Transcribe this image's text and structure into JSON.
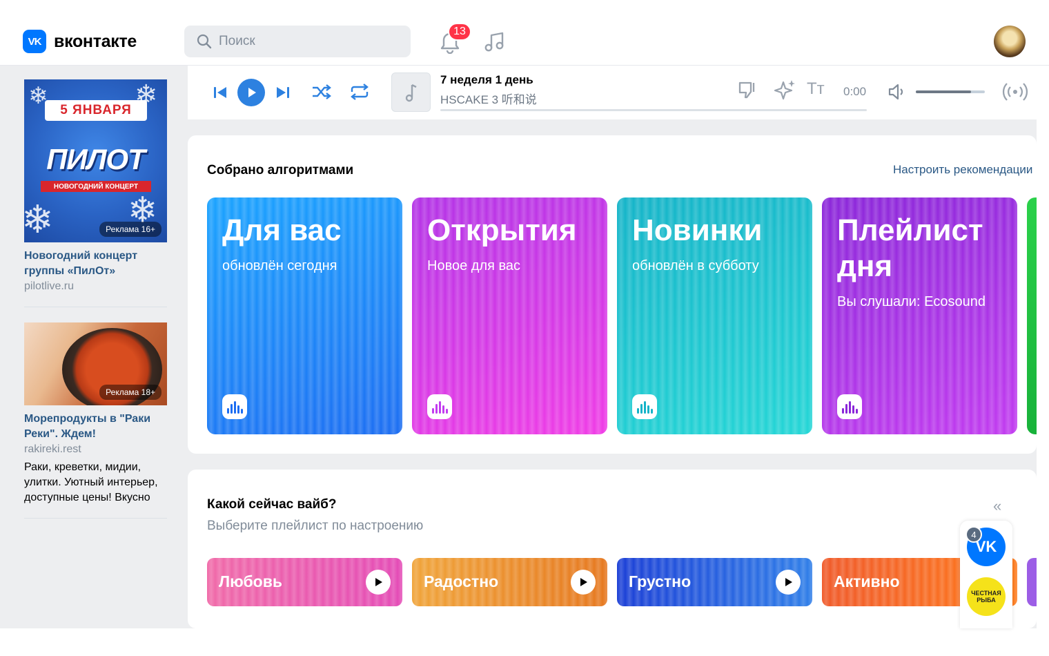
{
  "header": {
    "logo_mark": "VK",
    "logo_text": "вконтакте",
    "search_placeholder": "Поиск",
    "notifications_count": "13"
  },
  "sidebar": {
    "ads": [
      {
        "title": "Новогодний концерт группы «ПилОт»",
        "domain": "pilotlive.ru",
        "image_date": "5 ЯНВАРЯ",
        "image_title": "ПИЛОТ",
        "image_subtitle": "НОВОГОДНИЙ КОНЦЕРТ",
        "tag": "Реклама 16+"
      },
      {
        "title": "Морепродукты в \"Раки Реки\". Ждем!",
        "domain": "rakireki.rest",
        "description": "Раки, креветки, мидии, улитки. Уютный интерьер, доступные цены! Вкусно",
        "tag": "Реклама 18+"
      }
    ]
  },
  "player": {
    "track_title": "7 неделя 1 день",
    "track_artist": "HSCAKE 3 听和说",
    "time": "0:00",
    "text_button": "Tт",
    "volume": 0.8,
    "progress": 0.0
  },
  "algorithms": {
    "title": "Собрано алгоритмами",
    "link": "Настроить рекомендации",
    "tiles": [
      {
        "title": "Для вас",
        "subtitle": "обновлён сегодня",
        "color_a": "#1aa3ff",
        "color_b": "#1c6df2"
      },
      {
        "title": "Открытия",
        "subtitle": "Новое для вас",
        "color_a": "#b233e6",
        "color_b": "#f03ce6"
      },
      {
        "title": "Новинки",
        "subtitle": "обновлён в субботу",
        "color_a": "#14b3c8",
        "color_b": "#23d6d6"
      },
      {
        "title": "Плейлист дня",
        "subtitle": "Вы слушали: Ecosound",
        "color_a": "#8a26d9",
        "color_b": "#c23cf0"
      }
    ]
  },
  "vibe": {
    "title": "Какой сейчас вайб?",
    "subtitle": "Выберите плейлист по настроению",
    "collapse": "«",
    "moods": [
      {
        "label": "Любовь",
        "color_a": "#f06aa8",
        "color_b": "#e44bb6"
      },
      {
        "label": "Радостно",
        "color_a": "#f0a43a",
        "color_b": "#e6781f"
      },
      {
        "label": "Грустно",
        "color_a": "#1b3fd6",
        "color_b": "#2f7ee8"
      },
      {
        "label": "Активно",
        "color_a": "#f05a2a",
        "color_b": "#ff7a1a"
      }
    ]
  },
  "widget": {
    "vk_badge": "4",
    "vk_label": "VK",
    "fish_label": "ЧЕСТНАЯ РЫБА"
  }
}
